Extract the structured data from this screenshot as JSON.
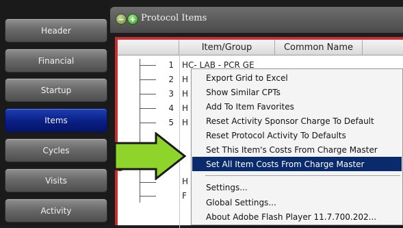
{
  "nav": {
    "items": [
      {
        "label": "Header"
      },
      {
        "label": "Financial"
      },
      {
        "label": "Startup"
      },
      {
        "label": "Items",
        "active": true
      },
      {
        "label": "Cycles"
      },
      {
        "label": "Visits"
      },
      {
        "label": "Activity"
      }
    ]
  },
  "header": {
    "title": "Protocol Items",
    "minus_icon": "minus-icon",
    "plus_icon": "plus-icon"
  },
  "grid": {
    "columns": [
      "Item/Group",
      "Common Name"
    ],
    "rows": [
      {
        "num": "1",
        "item": "HC- LAB - PCR GE"
      },
      {
        "num": "2",
        "item": "H"
      },
      {
        "num": "3",
        "item": "H"
      },
      {
        "num": "4",
        "item": "H"
      },
      {
        "num": "5",
        "item": "H"
      },
      {
        "num": "",
        "item": "H"
      },
      {
        "num": "",
        "item": "H"
      },
      {
        "num": "",
        "item": "F"
      }
    ]
  },
  "context_menu": {
    "groups": [
      [
        "Export Grid to Excel",
        "Show Similar CPTs",
        "Add To Item Favorites",
        "Reset Activity Sponsor Charge To Default",
        "Reset Protocol Activity To Defaults",
        "Set This Item's Costs From Charge Master",
        "Set All Item Costs From Charge Master"
      ],
      [
        "Settings...",
        "Global Settings...",
        "About Adobe Flash Player 11.7.700.202..."
      ]
    ],
    "highlighted": "Set All Item Costs From Charge Master"
  },
  "colors": {
    "nav_active": "#0a1f85",
    "menu_highlight": "#0a2a6e",
    "panel_border": "#c43030",
    "arrow_fill": "#8fd42a"
  }
}
